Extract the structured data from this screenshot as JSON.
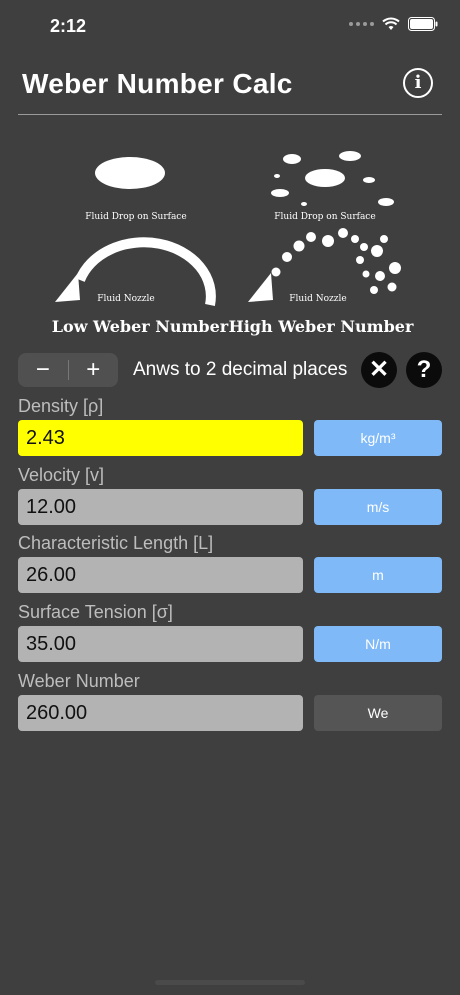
{
  "status": {
    "time": "2:12"
  },
  "header": {
    "title": "Weber Number Calc",
    "info_icon": "info-icon"
  },
  "illustration": {
    "low": {
      "drop_caption": "Fluid Drop on Surface",
      "nozzle_caption": "Fluid Nozzle",
      "title": "Low Weber Number"
    },
    "high": {
      "drop_caption": "Fluid Drop on Surface",
      "nozzle_caption": "Fluid Nozzle",
      "title": "High Weber Number"
    }
  },
  "controls": {
    "minus_label": "−",
    "plus_label": "+",
    "decimals_text": "Anws to 2 decimal places",
    "clear_label": "✕",
    "help_label": "?"
  },
  "fields": {
    "density": {
      "label": "Density [ρ]",
      "value": "2.43",
      "unit": "kg/m³"
    },
    "velocity": {
      "label": "Velocity [v]",
      "value": "12.00",
      "unit": "m/s"
    },
    "length": {
      "label": "Characteristic Length [L]",
      "value": "26.00",
      "unit": "m"
    },
    "tension": {
      "label": "Surface Tension [σ]",
      "value": "35.00",
      "unit": "N/m"
    },
    "weber": {
      "label": "Weber Number",
      "value": "260.00",
      "unit": "We"
    }
  },
  "colors": {
    "background": "#3f3f3f",
    "active_field": "#ffff00",
    "unit_button": "#7fb9f7"
  }
}
